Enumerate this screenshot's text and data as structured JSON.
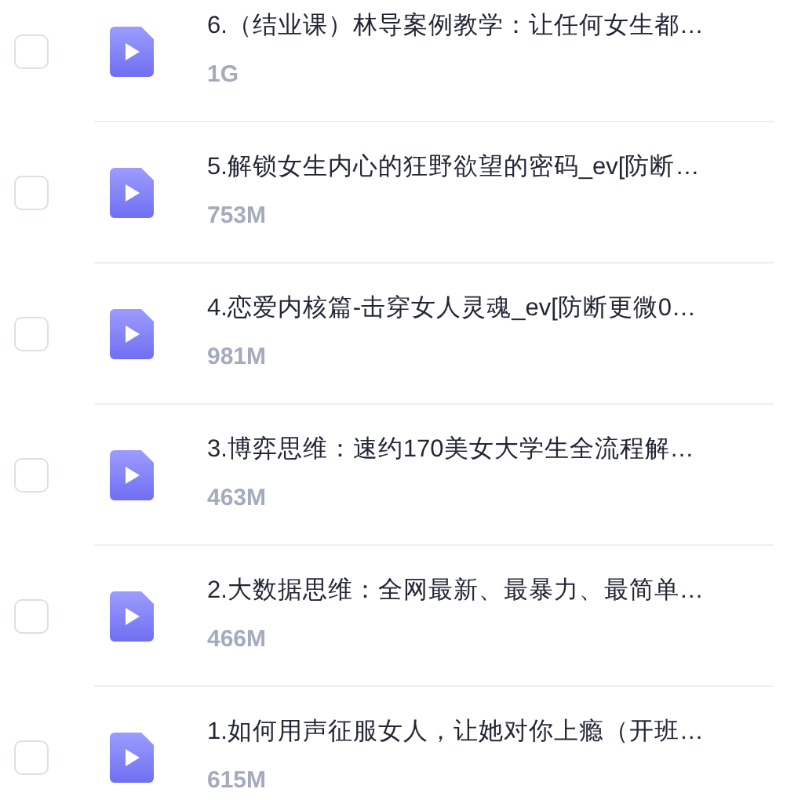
{
  "files": [
    {
      "title": "6.（结业课）林导案例教学：让任何女生都…",
      "size": "1G",
      "checked": false
    },
    {
      "title": "5.解锁女生内心的狂野欲望的密码_ev[防断…",
      "size": "753M",
      "checked": false
    },
    {
      "title": "4.恋爱内核篇-击穿女人灵魂_ev[防断更微0…",
      "size": "981M",
      "checked": false
    },
    {
      "title": "3.博弈思维：速约170美女大学生全流程解…",
      "size": "463M",
      "checked": false
    },
    {
      "title": "2.大数据思维：全网最新、最暴力、最简单…",
      "size": "466M",
      "checked": false
    },
    {
      "title": "1.如何用声征服女人，让她对你上瘾（开班…",
      "size": "615M",
      "checked": false
    }
  ]
}
